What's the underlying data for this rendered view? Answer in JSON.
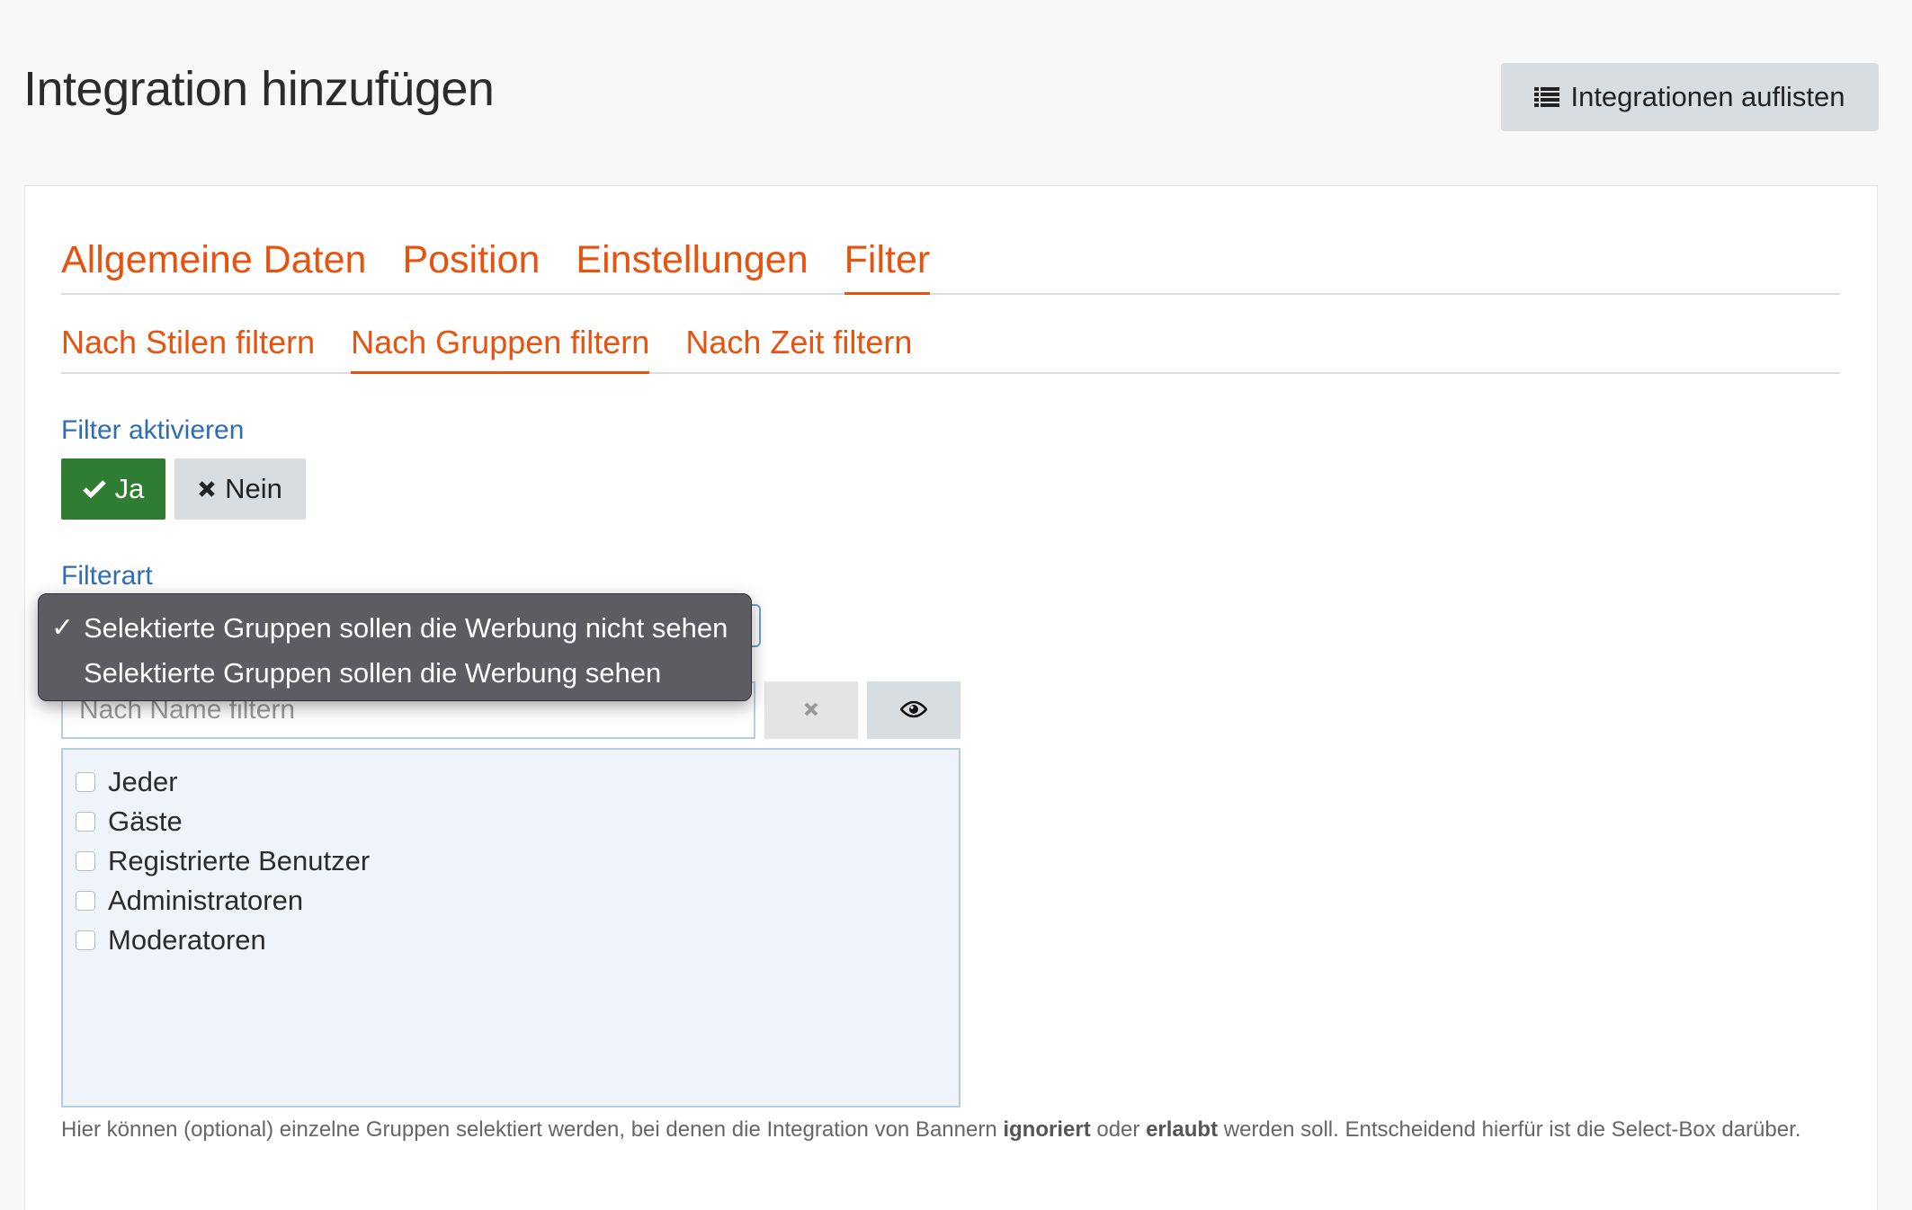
{
  "page": {
    "title": "Integration hinzufügen",
    "list_button": "Integrationen auflisten"
  },
  "tabs_main": [
    "Allgemeine Daten",
    "Position",
    "Einstellungen",
    "Filter"
  ],
  "tabs_main_active": "Filter",
  "tabs_sub": [
    "Nach Stilen filtern",
    "Nach Gruppen filtern",
    "Nach Zeit filtern"
  ],
  "tabs_sub_active": "Nach Gruppen filtern",
  "filter_enable": {
    "label": "Filter aktivieren",
    "yes": "Ja",
    "no": "Nein"
  },
  "filter_type": {
    "label": "Filterart",
    "options": [
      "Selektierte Gruppen sollen die Werbung nicht sehen",
      "Selektierte Gruppen sollen die Werbung sehen"
    ],
    "selected": "Selektierte Gruppen sollen die Werbung nicht sehen",
    "check_mark": "✓"
  },
  "name_filter": {
    "placeholder": "Nach Name filtern",
    "value": ""
  },
  "groups": [
    "Jeder",
    "Gäste",
    "Registrierte Benutzer",
    "Administratoren",
    "Moderatoren"
  ],
  "help": {
    "part1": "Hier können (optional) einzelne Gruppen selektiert werden, bei denen die Integration von Bannern ",
    "bold1": "ignoriert",
    "part2": " oder ",
    "bold2": "erlaubt",
    "part3": " werden soll. Entscheidend hierfür ist die Select-Box darüber."
  },
  "colors": {
    "accent": "#e8520f",
    "label_blue": "#2f6db3",
    "yes_green": "#2e7d32",
    "button_grey": "#d7dde0"
  },
  "icons": {
    "list_button": "list-icon",
    "yes": "check-icon",
    "no": "times-icon",
    "clear": "times-icon",
    "toggle": "eye-icon"
  }
}
